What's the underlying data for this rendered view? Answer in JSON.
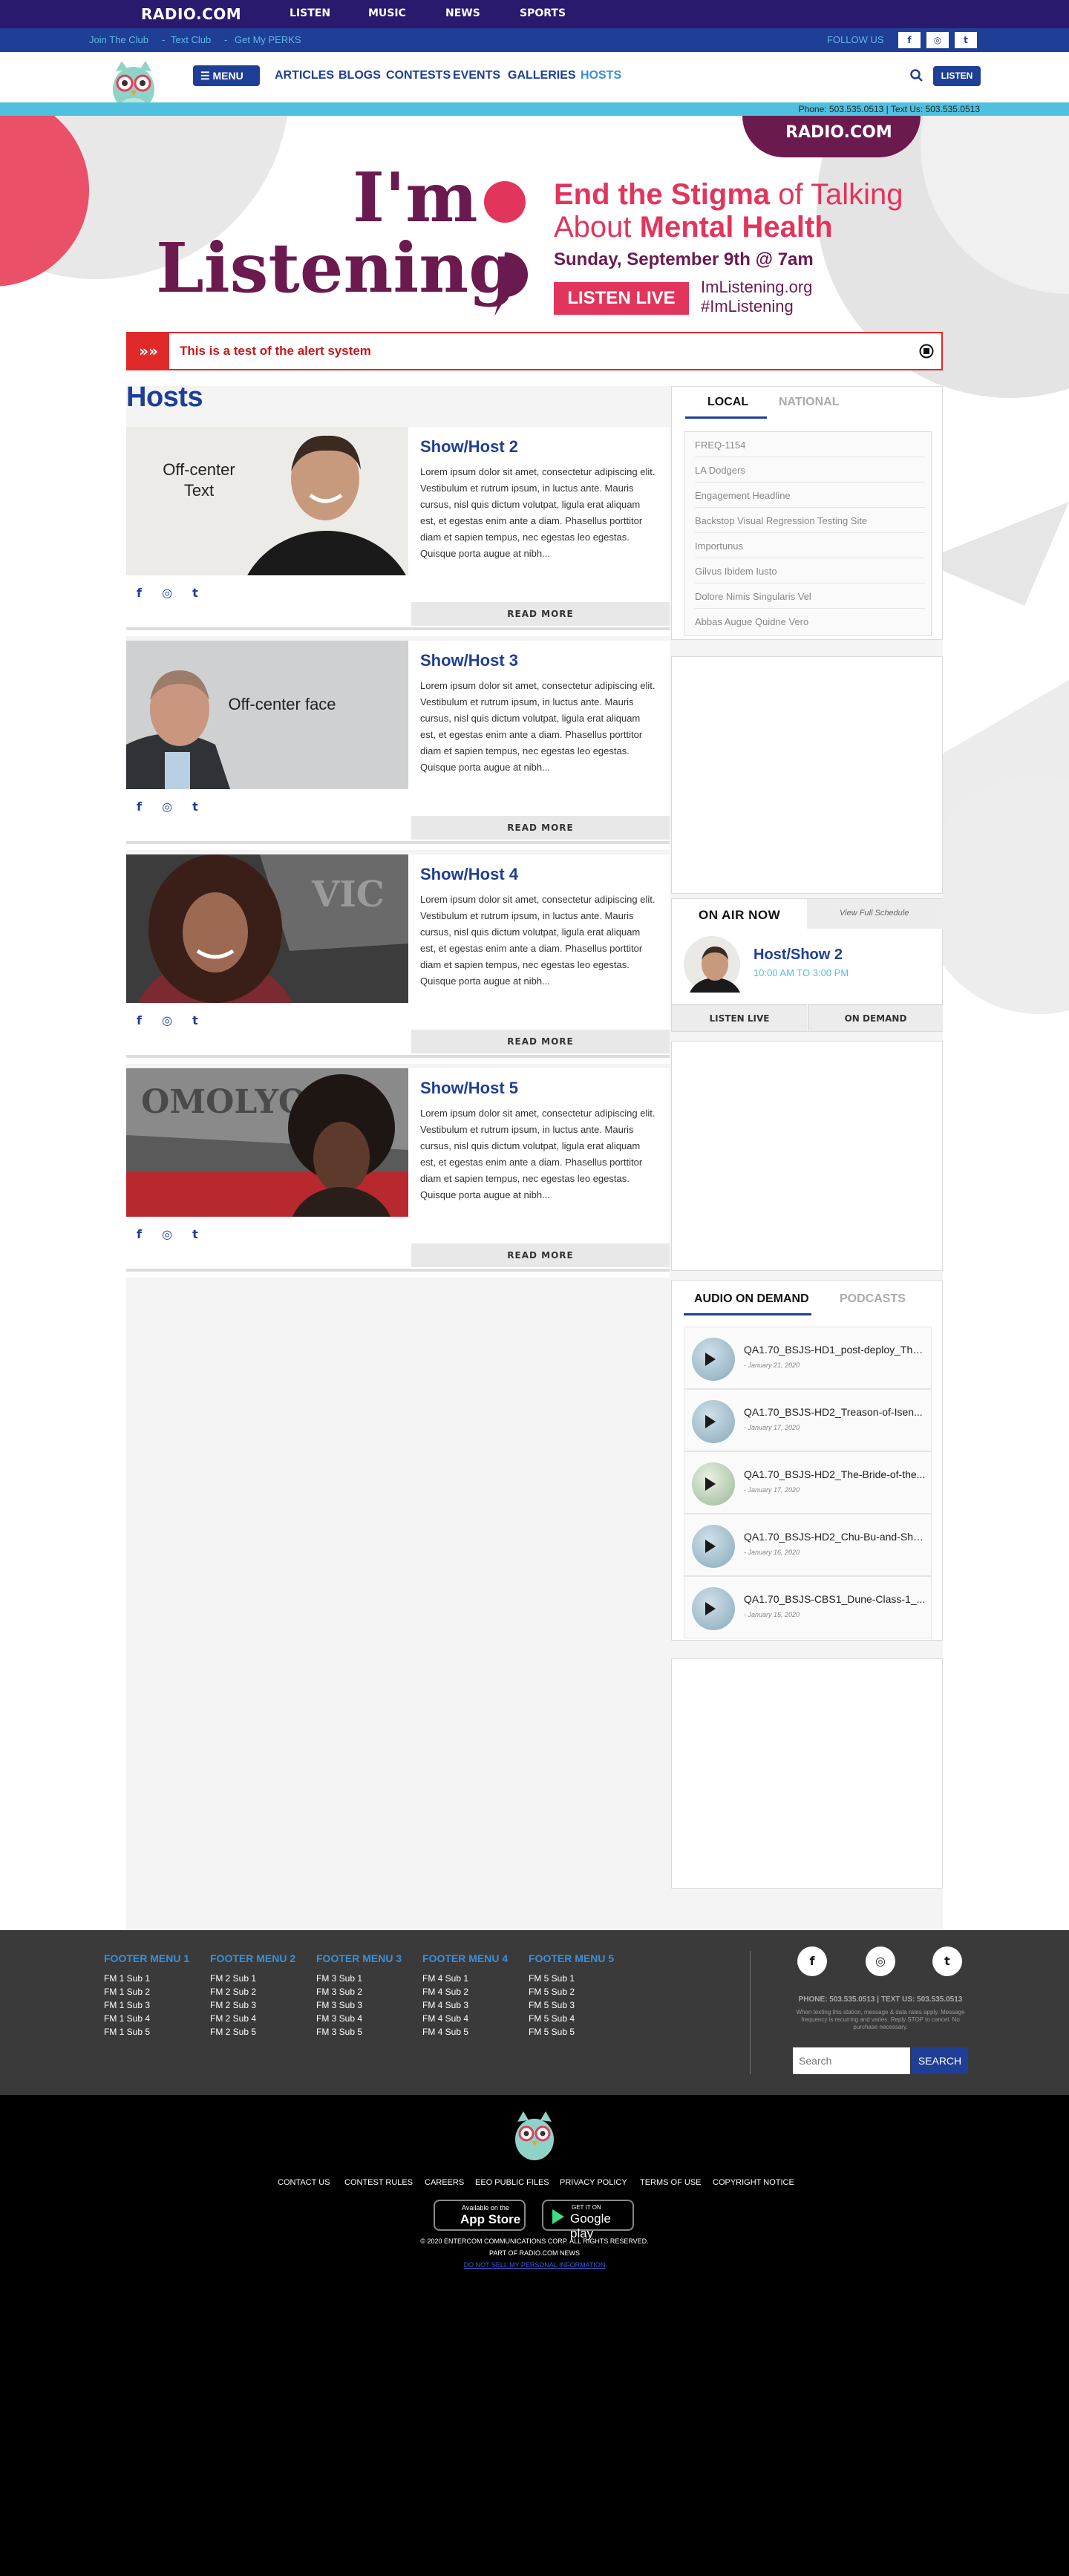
{
  "topbar": {
    "logo": "RADIO.COM",
    "nav": [
      "LISTEN",
      "MUSIC",
      "NEWS",
      "SPORTS"
    ]
  },
  "subbar": {
    "links": [
      "Join The Club",
      "Text Club",
      "Get My PERKS"
    ],
    "follow": "FOLLOW US",
    "socials": [
      "f",
      "◎",
      "t"
    ]
  },
  "navbar": {
    "menu": "MENU",
    "items": [
      "ARTICLES",
      "BLOGS",
      "CONTESTS",
      "EVENTS",
      "GALLERIES",
      "HOSTS"
    ],
    "active": "HOSTS",
    "listen": "LISTEN"
  },
  "phonebar": {
    "text": "Phone: 503.535.0513 | Text Us: 503.535.0513"
  },
  "banner": {
    "brand": "RADIO.COM",
    "im": "I'm",
    "listening": "Listening",
    "headline_1": "End the Stigma",
    "headline_2": "of Talking",
    "headline_3": "About",
    "headline_4": "Mental Health",
    "date": "Sunday, September 9th @ 7am",
    "cta": "LISTEN LIVE",
    "site": "ImListening.org",
    "hashtag": "#ImListening"
  },
  "alert": {
    "message": "This is a test of the alert system",
    "chevrons": "»»"
  },
  "page": {
    "title": "Hosts"
  },
  "hosts": [
    {
      "name": "Show/Host 2",
      "photo_text": "Off-center Text",
      "bio": "Lorem ipsum dolor sit amet, consectetur adipiscing elit. Vestibulum et rutrum ipsum, in luctus ante. Mauris cursus, nisl quis dictum volutpat, ligula erat aliquam est, et egestas enim ante a diam. Phasellus porttitor diam et sapien tempus, nec egestas leo egestas. Quisque porta augue at nibh...",
      "read_more": "READ MORE"
    },
    {
      "name": "Show/Host 3",
      "photo_text": "Off-center face",
      "bio": "Lorem ipsum dolor sit amet, consectetur adipiscing elit. Vestibulum et rutrum ipsum, in luctus ante. Mauris cursus, nisl quis dictum volutpat, ligula erat aliquam est, et egestas enim ante a diam. Phasellus porttitor diam et sapien tempus, nec egestas leo egestas. Quisque porta augue at nibh...",
      "read_more": "READ MORE"
    },
    {
      "name": "Show/Host 4",
      "photo_text": "",
      "bio": "Lorem ipsum dolor sit amet, consectetur adipiscing elit. Vestibulum et rutrum ipsum, in luctus ante. Mauris cursus, nisl quis dictum volutpat, ligula erat aliquam est, et egestas enim ante a diam. Phasellus porttitor diam et sapien tempus, nec egestas leo egestas. Quisque porta augue at nibh...",
      "read_more": "READ MORE"
    },
    {
      "name": "Show/Host 5",
      "photo_text": "",
      "bio": "Lorem ipsum dolor sit amet, consectetur adipiscing elit. Vestibulum et rutrum ipsum, in luctus ante. Mauris cursus, nisl quis dictum volutpat, ligula erat aliquam est, et egestas enim ante a diam. Phasellus porttitor diam et sapien tempus, nec egestas leo egestas. Quisque porta augue at nibh...",
      "read_more": "READ MORE"
    }
  ],
  "news": {
    "tabs": [
      "LOCAL",
      "NATIONAL"
    ],
    "items": [
      "FREQ-1154",
      "LA Dodgers",
      "Engagement Headline",
      "Backstop Visual Regression Testing Site",
      "Importunus",
      "Gilvus Ibidem Iusto",
      "Dolore Nimis Singularis Vel",
      "Abbas Augue Quidne Vero"
    ]
  },
  "onair": {
    "title": "ON AIR NOW",
    "schedule": "View Full Schedule",
    "show": "Host/Show 2",
    "time": "10:00 AM TO 3:00 PM",
    "listen_live": "LISTEN LIVE",
    "on_demand": "ON DEMAND"
  },
  "audio": {
    "tabs": [
      "AUDIO ON DEMAND",
      "PODCASTS"
    ],
    "items": [
      {
        "title": "QA1.70_BSJS-HD1_post-deploy_The...",
        "date": "- January 21, 2020"
      },
      {
        "title": "QA1.70_BSJS-HD2_Treason-of-Isen...",
        "date": "- January 17, 2020"
      },
      {
        "title": "QA1.70_BSJS-HD2_The-Bride-of-the...",
        "date": "- January 17, 2020"
      },
      {
        "title": "QA1.70_BSJS-HD2_Chu-Bu-and-She...",
        "date": "- January 16, 2020"
      },
      {
        "title": "QA1.70_BSJS-CBS1_Dune-Class-1_...",
        "date": "- January 15, 2020"
      }
    ]
  },
  "footer": {
    "menus": [
      {
        "title": "FOOTER MENU 1",
        "subs": [
          "FM 1 Sub 1",
          "FM 1 Sub 2",
          "FM 1 Sub 3",
          "FM 1 Sub 4",
          "FM 1 Sub 5"
        ]
      },
      {
        "title": "FOOTER MENU 2",
        "subs": [
          "FM 2 Sub 1",
          "FM 2 Sub 2",
          "FM 2 Sub 3",
          "FM 2 Sub 4",
          "FM 2 Sub 5"
        ]
      },
      {
        "title": "FOOTER MENU 3",
        "subs": [
          "FM 3 Sub 1",
          "FM 3 Sub 2",
          "FM 3 Sub 3",
          "FM 3 Sub 4",
          "FM 3 Sub 5"
        ]
      },
      {
        "title": "FOOTER MENU 4",
        "subs": [
          "FM 4 Sub 1",
          "FM 4 Sub 2",
          "FM 4 Sub 3",
          "FM 4 Sub 4",
          "FM 4 Sub 5"
        ]
      },
      {
        "title": "FOOTER MENU 5",
        "subs": [
          "FM 5 Sub 1",
          "FM 5 Sub 2",
          "FM 5 Sub 3",
          "FM 5 Sub 4",
          "FM 5 Sub 5"
        ]
      }
    ],
    "contact": "PHONE: 503.535.0513 | TEXT US: 503.535.0513",
    "disclaimer": "When texting this station, message & data rates apply. Message frequency is recurring and varies. Reply STOP to cancel. No purchase necessary.",
    "search_placeholder": "Search",
    "search_button": "SEARCH",
    "links": [
      "CONTACT US",
      "CONTEST RULES",
      "CAREERS",
      "EEO PUBLIC FILES",
      "PRIVACY POLICY",
      "TERMS OF USE",
      "COPYRIGHT NOTICE"
    ],
    "app_store": {
      "small": "Available on the",
      "big": "App Store"
    },
    "google_play": {
      "small": "GET IT ON",
      "big": "Google play"
    },
    "copyright": "© 2020 ENTERCOM COMMUNICATIONS CORP. ALL RIGHTS RESERVED.",
    "part_of": "PART OF RADIO.COM NEWS",
    "do_not_sell": "DO NOT SELL MY PERSONAL INFORMATION"
  }
}
